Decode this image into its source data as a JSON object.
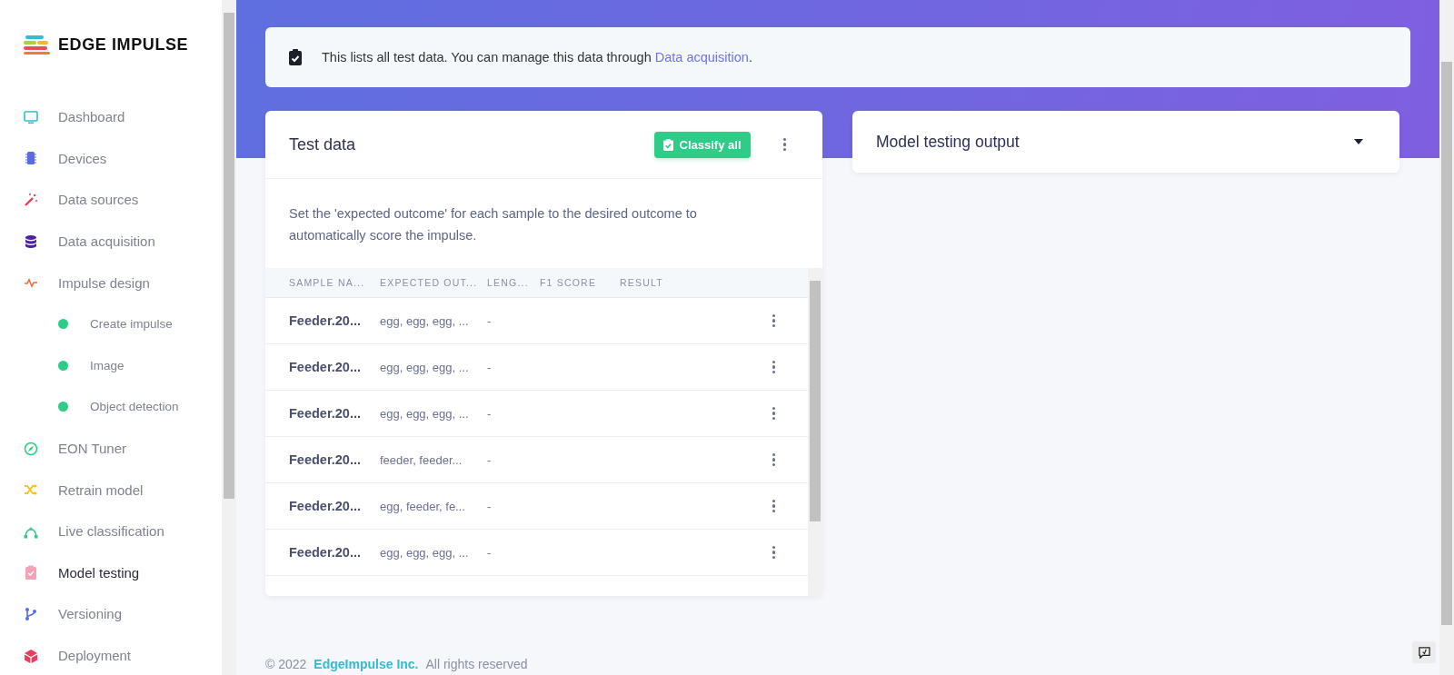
{
  "logo": {
    "text": "EDGE IMPULSE"
  },
  "sidebar": {
    "items": [
      {
        "label": "Dashboard",
        "kind": "item",
        "selected": false
      },
      {
        "label": "Devices",
        "kind": "item",
        "selected": false
      },
      {
        "label": "Data sources",
        "kind": "item",
        "selected": false
      },
      {
        "label": "Data acquisition",
        "kind": "item",
        "selected": false
      },
      {
        "label": "Impulse design",
        "kind": "item",
        "selected": false,
        "children": [
          {
            "label": "Create impulse",
            "kind": "subitem",
            "selected": false,
            "color": "#2ecc86"
          },
          {
            "label": "Image",
            "kind": "subitem",
            "selected": false,
            "color": "#2ecc86"
          },
          {
            "label": "Object detection",
            "kind": "subitem",
            "selected": false,
            "color": "#2ecc86"
          }
        ]
      },
      {
        "label": "EON Tuner",
        "kind": "item",
        "selected": false
      },
      {
        "label": "Retrain model",
        "kind": "item",
        "selected": false
      },
      {
        "label": "Live classification",
        "kind": "item",
        "selected": false
      },
      {
        "label": "Model testing",
        "kind": "item",
        "selected": true
      },
      {
        "label": "Versioning",
        "kind": "item",
        "selected": false
      },
      {
        "label": "Deployment",
        "kind": "item",
        "selected": false
      }
    ]
  },
  "info": {
    "text": "This lists all test data. You can manage this data through ",
    "link": "Data acquisition",
    "after": "."
  },
  "test_data": {
    "title": "Test data",
    "button": "Classify all",
    "description": "Set the 'expected outcome' for each sample to the desired outcome to automatically score the impulse.",
    "columns": [
      "SAMPLE NA...",
      "EXPECTED OUT...",
      "LENG...",
      "F1 SCORE",
      "RESULT"
    ],
    "rows": [
      {
        "name": "Feeder.20...",
        "expected": "egg, egg, egg, ...",
        "length": "-"
      },
      {
        "name": "Feeder.20...",
        "expected": "egg, egg, egg, ...",
        "length": "-"
      },
      {
        "name": "Feeder.20...",
        "expected": "egg, egg, egg, ...",
        "length": "-"
      },
      {
        "name": "Feeder.20...",
        "expected": "feeder, feeder...",
        "length": "-"
      },
      {
        "name": "Feeder.20...",
        "expected": "egg, feeder, fe...",
        "length": "-"
      },
      {
        "name": "Feeder.20...",
        "expected": "egg, egg, egg, ...",
        "length": "-"
      }
    ]
  },
  "output": {
    "title": "Model testing output",
    "expanded": false
  },
  "footer": {
    "copyright": "© 2022",
    "link": "EdgeImpulse Inc.",
    "rest": "All rights reserved"
  }
}
